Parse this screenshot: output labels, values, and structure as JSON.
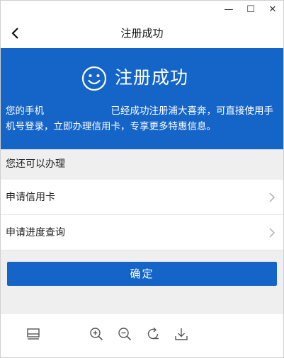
{
  "window": {
    "controls": {
      "minimize": "—",
      "maximize": "☐",
      "close": "✕"
    }
  },
  "nav": {
    "title": "注册成功",
    "back_icon": "chevron-left-icon"
  },
  "banner": {
    "title": "注册成功",
    "icon": "smiley-icon",
    "message": "您的手机　　　　　　　已经成功注册浦大喜奔，可直接使用手机号登录，立即办理信用卡，专享更多特惠信息。"
  },
  "section": {
    "title": "您还可以办理"
  },
  "menu": {
    "items": [
      {
        "label": "申请信用卡"
      },
      {
        "label": "申请进度查询"
      }
    ]
  },
  "actions": {
    "confirm_label": "确定"
  },
  "toolbar": {
    "tools": [
      "layout-icon",
      "zoom-in-icon",
      "zoom-out-icon",
      "rotate-icon",
      "download-icon"
    ]
  },
  "colors": {
    "brand_blue": "#1565c8",
    "section_bg": "#efefef"
  }
}
